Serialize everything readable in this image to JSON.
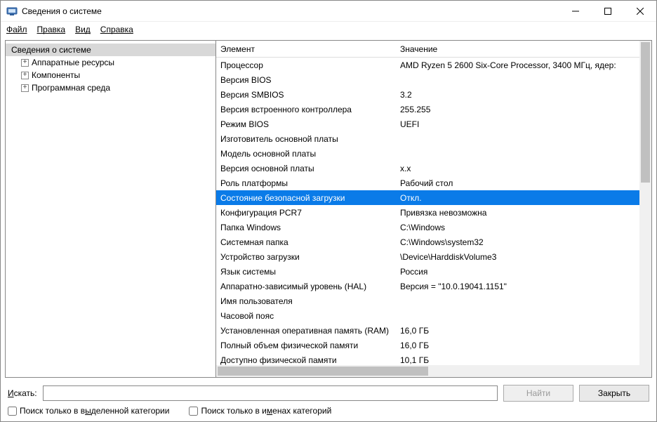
{
  "window": {
    "title": "Сведения о системе"
  },
  "menu": {
    "file": "Файл",
    "edit": "Правка",
    "view": "Вид",
    "help": "Справка"
  },
  "tree": {
    "root": "Сведения о системе",
    "items": [
      "Аппаратные ресурсы",
      "Компоненты",
      "Программная среда"
    ]
  },
  "columns": {
    "element": "Элемент",
    "value": "Значение"
  },
  "rows": [
    {
      "el": "Процессор",
      "val": "AMD Ryzen 5 2600 Six-Core Processor, 3400 МГц, ядер:"
    },
    {
      "el": "Версия BIOS",
      "val": ""
    },
    {
      "el": "Версия SMBIOS",
      "val": "3.2"
    },
    {
      "el": "Версия встроенного контроллера",
      "val": "255.255"
    },
    {
      "el": "Режим BIOS",
      "val": "UEFI"
    },
    {
      "el": "Изготовитель основной платы",
      "val": ""
    },
    {
      "el": "Модель основной платы",
      "val": ""
    },
    {
      "el": "Версия основной платы",
      "val": "x.x"
    },
    {
      "el": "Роль платформы",
      "val": "Рабочий стол"
    },
    {
      "el": "Состояние безопасной загрузки",
      "val": "Откл.",
      "selected": true
    },
    {
      "el": "Конфигурация PCR7",
      "val": "Привязка невозможна"
    },
    {
      "el": "Папка Windows",
      "val": "C:\\Windows"
    },
    {
      "el": "Системная папка",
      "val": "C:\\Windows\\system32"
    },
    {
      "el": "Устройство загрузки",
      "val": "\\Device\\HarddiskVolume3"
    },
    {
      "el": "Язык системы",
      "val": "Россия"
    },
    {
      "el": "Аппаратно-зависимый уровень (HAL)",
      "val": "Версия = \"10.0.19041.1151\""
    },
    {
      "el": "Имя пользователя",
      "val": ""
    },
    {
      "el": "Часовой пояс",
      "val": ""
    },
    {
      "el": "Установленная оперативная память (RAM)",
      "val": "16,0 ГБ"
    },
    {
      "el": "Полный объем физической памяти",
      "val": "16,0 ГБ"
    },
    {
      "el": "Доступно физической памяти",
      "val": "10,1 ГБ"
    }
  ],
  "search": {
    "label_prefix": "И",
    "label_rest": "скать:",
    "find": "Найти",
    "close": "Закрыть",
    "placeholder": ""
  },
  "checks": {
    "cat_prefix": "Поиск только в в",
    "cat_ul": "ы",
    "cat_rest": "деленной категории",
    "name_prefix": "Поиск только в и",
    "name_ul": "м",
    "name_rest": "енах категорий"
  }
}
